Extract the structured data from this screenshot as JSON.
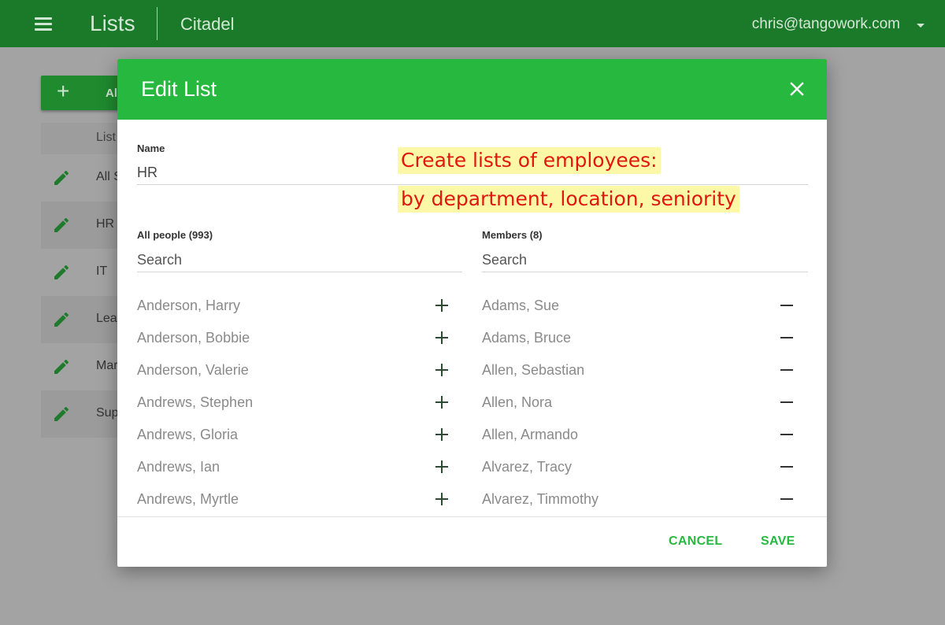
{
  "appbar": {
    "title": "Lists",
    "org": "Citadel",
    "user_email": "chris@tangowork.com",
    "color": "#1a7a2a"
  },
  "background": {
    "add_button_label": "Al",
    "table_header": "List",
    "rows": [
      {
        "label": "All S"
      },
      {
        "label": "HR"
      },
      {
        "label": "IT"
      },
      {
        "label": "Lea"
      },
      {
        "label": "Mar"
      },
      {
        "label": "Sup"
      }
    ]
  },
  "dialog": {
    "title": "Edit List",
    "header_color": "#27b93f",
    "name_label": "Name",
    "name_value": "HR",
    "all_people_label": "All people (993)",
    "members_label": "Members (8)",
    "all_search_placeholder": "Search",
    "members_search_placeholder": "Search",
    "all_people": [
      "Anderson, Harry",
      "Anderson, Bobbie",
      "Anderson, Valerie",
      "Andrews, Stephen",
      "Andrews, Gloria",
      "Andrews, Ian",
      "Andrews, Myrtle"
    ],
    "members": [
      "Adams, Sue",
      "Adams, Bruce",
      "Allen, Sebastian",
      "Allen, Nora",
      "Allen, Armando",
      "Alvarez, Tracy",
      "Alvarez, Timmothy"
    ],
    "cancel_label": "CANCEL",
    "save_label": "SAVE"
  },
  "annotation": {
    "line1": "Create lists of employees:",
    "line2": "by department, location, seniority",
    "text_color": "#e0170f",
    "highlight_color": "#fdf7a8"
  }
}
